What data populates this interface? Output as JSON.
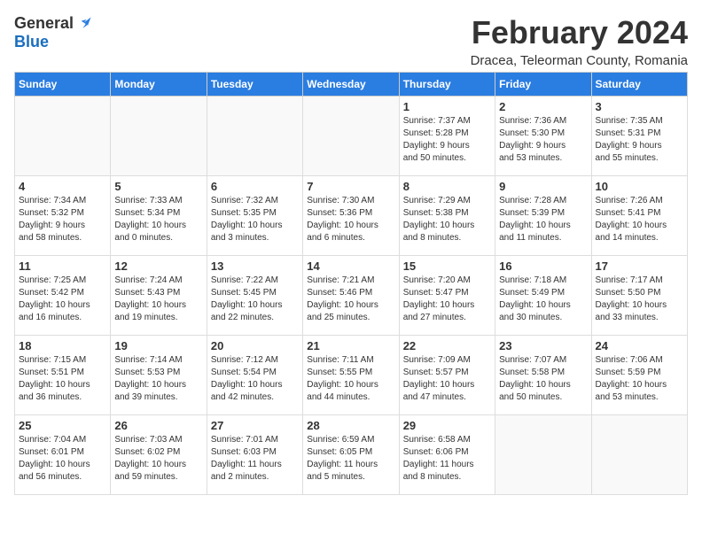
{
  "header": {
    "logo_general": "General",
    "logo_blue": "Blue",
    "month_title": "February 2024",
    "location": "Dracea, Teleorman County, Romania"
  },
  "days_of_week": [
    "Sunday",
    "Monday",
    "Tuesday",
    "Wednesday",
    "Thursday",
    "Friday",
    "Saturday"
  ],
  "weeks": [
    [
      {
        "day": "",
        "info": ""
      },
      {
        "day": "",
        "info": ""
      },
      {
        "day": "",
        "info": ""
      },
      {
        "day": "",
        "info": ""
      },
      {
        "day": "1",
        "info": "Sunrise: 7:37 AM\nSunset: 5:28 PM\nDaylight: 9 hours\nand 50 minutes."
      },
      {
        "day": "2",
        "info": "Sunrise: 7:36 AM\nSunset: 5:30 PM\nDaylight: 9 hours\nand 53 minutes."
      },
      {
        "day": "3",
        "info": "Sunrise: 7:35 AM\nSunset: 5:31 PM\nDaylight: 9 hours\nand 55 minutes."
      }
    ],
    [
      {
        "day": "4",
        "info": "Sunrise: 7:34 AM\nSunset: 5:32 PM\nDaylight: 9 hours\nand 58 minutes."
      },
      {
        "day": "5",
        "info": "Sunrise: 7:33 AM\nSunset: 5:34 PM\nDaylight: 10 hours\nand 0 minutes."
      },
      {
        "day": "6",
        "info": "Sunrise: 7:32 AM\nSunset: 5:35 PM\nDaylight: 10 hours\nand 3 minutes."
      },
      {
        "day": "7",
        "info": "Sunrise: 7:30 AM\nSunset: 5:36 PM\nDaylight: 10 hours\nand 6 minutes."
      },
      {
        "day": "8",
        "info": "Sunrise: 7:29 AM\nSunset: 5:38 PM\nDaylight: 10 hours\nand 8 minutes."
      },
      {
        "day": "9",
        "info": "Sunrise: 7:28 AM\nSunset: 5:39 PM\nDaylight: 10 hours\nand 11 minutes."
      },
      {
        "day": "10",
        "info": "Sunrise: 7:26 AM\nSunset: 5:41 PM\nDaylight: 10 hours\nand 14 minutes."
      }
    ],
    [
      {
        "day": "11",
        "info": "Sunrise: 7:25 AM\nSunset: 5:42 PM\nDaylight: 10 hours\nand 16 minutes."
      },
      {
        "day": "12",
        "info": "Sunrise: 7:24 AM\nSunset: 5:43 PM\nDaylight: 10 hours\nand 19 minutes."
      },
      {
        "day": "13",
        "info": "Sunrise: 7:22 AM\nSunset: 5:45 PM\nDaylight: 10 hours\nand 22 minutes."
      },
      {
        "day": "14",
        "info": "Sunrise: 7:21 AM\nSunset: 5:46 PM\nDaylight: 10 hours\nand 25 minutes."
      },
      {
        "day": "15",
        "info": "Sunrise: 7:20 AM\nSunset: 5:47 PM\nDaylight: 10 hours\nand 27 minutes."
      },
      {
        "day": "16",
        "info": "Sunrise: 7:18 AM\nSunset: 5:49 PM\nDaylight: 10 hours\nand 30 minutes."
      },
      {
        "day": "17",
        "info": "Sunrise: 7:17 AM\nSunset: 5:50 PM\nDaylight: 10 hours\nand 33 minutes."
      }
    ],
    [
      {
        "day": "18",
        "info": "Sunrise: 7:15 AM\nSunset: 5:51 PM\nDaylight: 10 hours\nand 36 minutes."
      },
      {
        "day": "19",
        "info": "Sunrise: 7:14 AM\nSunset: 5:53 PM\nDaylight: 10 hours\nand 39 minutes."
      },
      {
        "day": "20",
        "info": "Sunrise: 7:12 AM\nSunset: 5:54 PM\nDaylight: 10 hours\nand 42 minutes."
      },
      {
        "day": "21",
        "info": "Sunrise: 7:11 AM\nSunset: 5:55 PM\nDaylight: 10 hours\nand 44 minutes."
      },
      {
        "day": "22",
        "info": "Sunrise: 7:09 AM\nSunset: 5:57 PM\nDaylight: 10 hours\nand 47 minutes."
      },
      {
        "day": "23",
        "info": "Sunrise: 7:07 AM\nSunset: 5:58 PM\nDaylight: 10 hours\nand 50 minutes."
      },
      {
        "day": "24",
        "info": "Sunrise: 7:06 AM\nSunset: 5:59 PM\nDaylight: 10 hours\nand 53 minutes."
      }
    ],
    [
      {
        "day": "25",
        "info": "Sunrise: 7:04 AM\nSunset: 6:01 PM\nDaylight: 10 hours\nand 56 minutes."
      },
      {
        "day": "26",
        "info": "Sunrise: 7:03 AM\nSunset: 6:02 PM\nDaylight: 10 hours\nand 59 minutes."
      },
      {
        "day": "27",
        "info": "Sunrise: 7:01 AM\nSunset: 6:03 PM\nDaylight: 11 hours\nand 2 minutes."
      },
      {
        "day": "28",
        "info": "Sunrise: 6:59 AM\nSunset: 6:05 PM\nDaylight: 11 hours\nand 5 minutes."
      },
      {
        "day": "29",
        "info": "Sunrise: 6:58 AM\nSunset: 6:06 PM\nDaylight: 11 hours\nand 8 minutes."
      },
      {
        "day": "",
        "info": ""
      },
      {
        "day": "",
        "info": ""
      }
    ]
  ]
}
